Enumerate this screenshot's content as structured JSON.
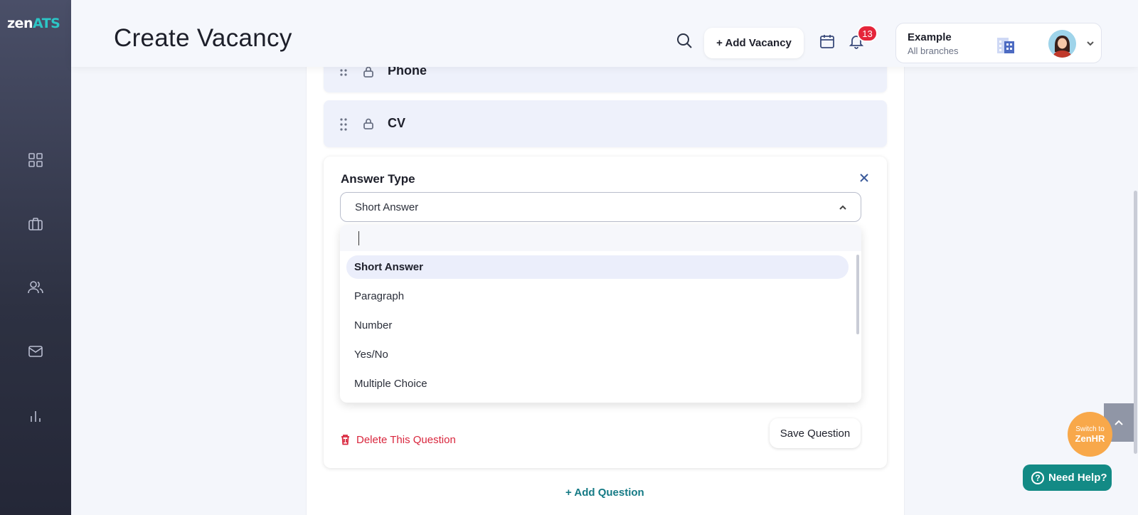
{
  "app": {
    "logo_main": "zen",
    "logo_accent": "ATS"
  },
  "sidebar": {
    "items": [
      {
        "icon": "dashboard-icon"
      },
      {
        "icon": "briefcase-icon"
      },
      {
        "icon": "users-icon"
      },
      {
        "icon": "mail-icon"
      },
      {
        "icon": "bar-chart-icon"
      }
    ]
  },
  "header": {
    "title": "Create Vacancy",
    "add_vacancy_label": "+ Add Vacancy",
    "notification_count": "13",
    "company_name": "Example",
    "branch_label": "All branches"
  },
  "form": {
    "fields": [
      {
        "label": "Phone"
      },
      {
        "label": "CV"
      }
    ],
    "question": {
      "answer_type_label": "Answer Type",
      "selected_value": "Short Answer",
      "search_value": "",
      "options": [
        "Short Answer",
        "Paragraph",
        "Number",
        "Yes/No",
        "Multiple Choice"
      ],
      "delete_label": "Delete This Question",
      "save_label": "Save Question"
    },
    "add_question_label": "+ Add Question"
  },
  "widgets": {
    "switch_small": "Switch to",
    "switch_big": "ZenHR",
    "help_label": "Need Help?",
    "help_glyph": "?"
  },
  "colors": {
    "accent_teal": "#2cc6c6",
    "danger": "#d9263d",
    "switch_orange": "#f8a84a",
    "help_teal": "#138a85"
  }
}
